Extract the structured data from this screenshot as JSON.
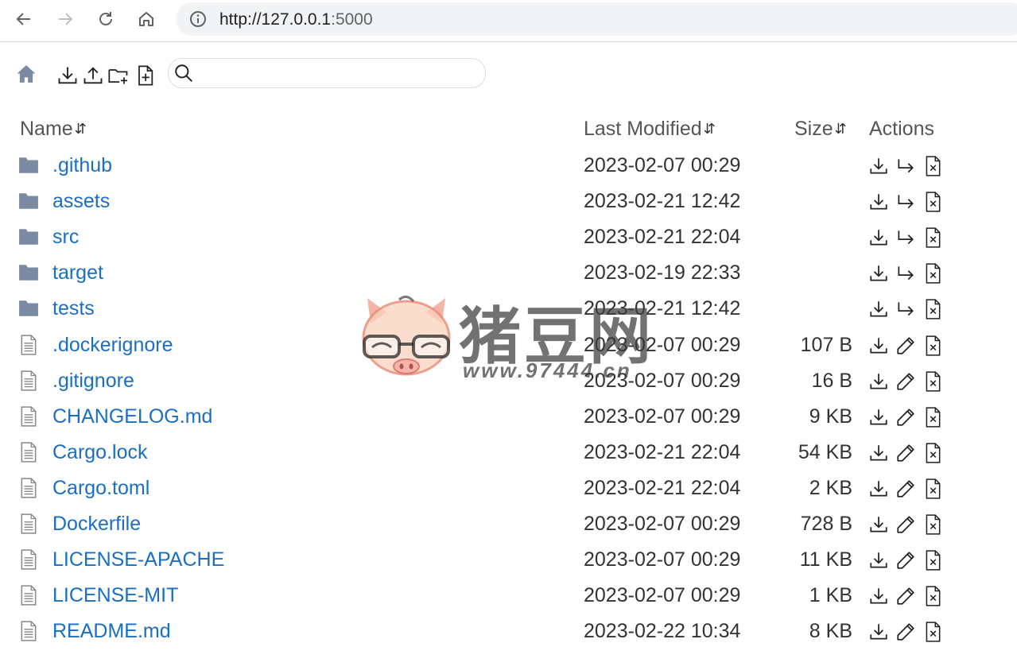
{
  "browser": {
    "url_host": "http://127.0.0.1",
    "url_port": ":5000"
  },
  "search": {
    "value": "",
    "placeholder": ""
  },
  "table": {
    "headers": {
      "name": "Name",
      "modified": "Last Modified",
      "size": "Size",
      "actions": "Actions"
    },
    "rows": [
      {
        "type": "folder",
        "name": ".github",
        "modified": "2023-02-07 00:29",
        "size": ""
      },
      {
        "type": "folder",
        "name": "assets",
        "modified": "2023-02-21 12:42",
        "size": ""
      },
      {
        "type": "folder",
        "name": "src",
        "modified": "2023-02-21 22:04",
        "size": ""
      },
      {
        "type": "folder",
        "name": "target",
        "modified": "2023-02-19 22:33",
        "size": ""
      },
      {
        "type": "folder",
        "name": "tests",
        "modified": "2023-02-21 12:42",
        "size": ""
      },
      {
        "type": "file",
        "name": ".dockerignore",
        "modified": "2023-02-07 00:29",
        "size": "107 B"
      },
      {
        "type": "file",
        "name": ".gitignore",
        "modified": "2023-02-07 00:29",
        "size": "16 B"
      },
      {
        "type": "file",
        "name": "CHANGELOG.md",
        "modified": "2023-02-07 00:29",
        "size": "9 KB"
      },
      {
        "type": "file",
        "name": "Cargo.lock",
        "modified": "2023-02-21 22:04",
        "size": "54 KB"
      },
      {
        "type": "file",
        "name": "Cargo.toml",
        "modified": "2023-02-21 22:04",
        "size": "2 KB"
      },
      {
        "type": "file",
        "name": "Dockerfile",
        "modified": "2023-02-07 00:29",
        "size": "728 B"
      },
      {
        "type": "file",
        "name": "LICENSE-APACHE",
        "modified": "2023-02-07 00:29",
        "size": "11 KB"
      },
      {
        "type": "file",
        "name": "LICENSE-MIT",
        "modified": "2023-02-07 00:29",
        "size": "1 KB"
      },
      {
        "type": "file",
        "name": "README.md",
        "modified": "2023-02-22 10:34",
        "size": "8 KB"
      }
    ]
  },
  "watermark": {
    "brand": "猪豆网",
    "site": "www.97444.cn"
  },
  "colors": {
    "link": "#1a6fc4",
    "folder_icon": "#7a8aa3",
    "omnibox_bg": "#f1f3f4"
  },
  "icons": {
    "back": "arrow-left-icon",
    "forward": "arrow-right-icon",
    "reload": "reload-icon",
    "home": "home-icon",
    "site_info": "info-icon",
    "toolbar_home": "house-icon",
    "download_all": "download-icon",
    "upload": "upload-icon",
    "new_folder": "folder-plus-icon",
    "new_file": "file-plus-icon",
    "search": "search-icon",
    "row_download": "download-icon",
    "row_move": "move-arrow-icon",
    "row_edit": "pencil-icon",
    "row_delete": "file-x-icon",
    "folder": "folder-icon",
    "file": "file-text-icon"
  }
}
